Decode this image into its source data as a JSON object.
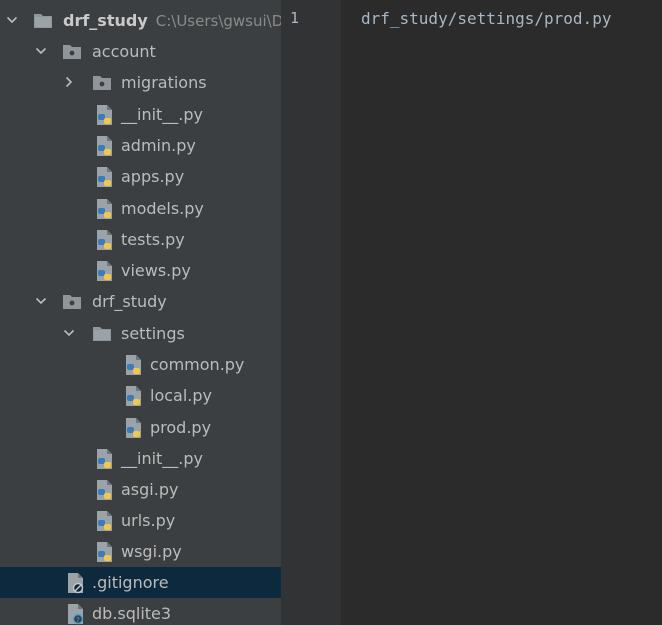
{
  "project_tree": {
    "root": {
      "label": "drf_study",
      "path": "C:\\Users\\gwsui\\D"
    },
    "items": [
      {
        "label": "account",
        "kind": "folder"
      },
      {
        "label": "migrations",
        "kind": "folder"
      },
      {
        "label": "__init__.py",
        "kind": "python-file"
      },
      {
        "label": "admin.py",
        "kind": "python-file"
      },
      {
        "label": "apps.py",
        "kind": "python-file"
      },
      {
        "label": "models.py",
        "kind": "python-file"
      },
      {
        "label": "tests.py",
        "kind": "python-file"
      },
      {
        "label": "views.py",
        "kind": "python-file"
      },
      {
        "label": "drf_study",
        "kind": "folder"
      },
      {
        "label": "settings",
        "kind": "folder"
      },
      {
        "label": "common.py",
        "kind": "python-file"
      },
      {
        "label": "local.py",
        "kind": "python-file"
      },
      {
        "label": "prod.py",
        "kind": "python-file"
      },
      {
        "label": "__init__.py",
        "kind": "python-file"
      },
      {
        "label": "asgi.py",
        "kind": "python-file"
      },
      {
        "label": "urls.py",
        "kind": "python-file"
      },
      {
        "label": "wsgi.py",
        "kind": "python-file"
      },
      {
        "label": ".gitignore",
        "kind": "ignored-file"
      },
      {
        "label": "db.sqlite3",
        "kind": "unknown-file"
      }
    ]
  },
  "editor": {
    "line_number": "1",
    "code_line": "drf_study/settings/prod.py"
  },
  "colors": {
    "sidebar_bg": "#3c3f41",
    "editor_bg": "#2b2b2b",
    "selection": "#0d293e",
    "python_blue": "#3d7ab8",
    "python_yellow": "#f3c74a"
  }
}
